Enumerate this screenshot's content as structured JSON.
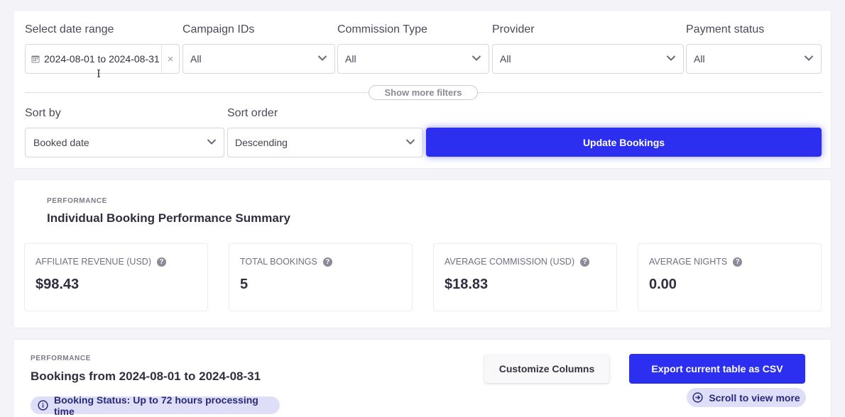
{
  "filters": {
    "date_range": {
      "label": "Select date range",
      "value": "2024-08-01 to 2024-08-31",
      "clear_glyph": "×"
    },
    "campaign_ids": {
      "label": "Campaign IDs",
      "value": "All"
    },
    "commission_type": {
      "label": "Commission Type",
      "value": "All"
    },
    "provider": {
      "label": "Provider",
      "value": "All"
    },
    "payment_status": {
      "label": "Payment status",
      "value": "All"
    },
    "show_more_label": "Show more filters",
    "sort_by": {
      "label": "Sort by",
      "value": "Booked date"
    },
    "sort_order": {
      "label": "Sort order",
      "value": "Descending"
    },
    "update_button_label": "Update Bookings"
  },
  "summary": {
    "eyebrow": "PERFORMANCE",
    "title": "Individual Booking Performance Summary",
    "stats": [
      {
        "label": "AFFILIATE REVENUE (USD)",
        "value": "$98.43"
      },
      {
        "label": "TOTAL BOOKINGS",
        "value": "5"
      },
      {
        "label": "AVERAGE COMMISSION (USD)",
        "value": "$18.83"
      },
      {
        "label": "AVERAGE NIGHTS",
        "value": "0.00"
      }
    ],
    "help_glyph": "?"
  },
  "bookings": {
    "eyebrow": "PERFORMANCE",
    "title": "Bookings from 2024-08-01 to 2024-08-31",
    "status_text": "Booking Status: Up to 72 hours processing time",
    "customize_label": "Customize Columns",
    "export_label": "Export current table as CSV",
    "scroll_label": "Scroll to view more"
  },
  "colors": {
    "accent": "#2d2ff0",
    "pill_background": "#dedef8",
    "page_background": "#f3f3f8"
  },
  "icons": [
    "calendar-icon",
    "clear-icon",
    "chevron-down-icon",
    "help-icon",
    "info-icon",
    "arrow-right-circle-icon"
  ]
}
